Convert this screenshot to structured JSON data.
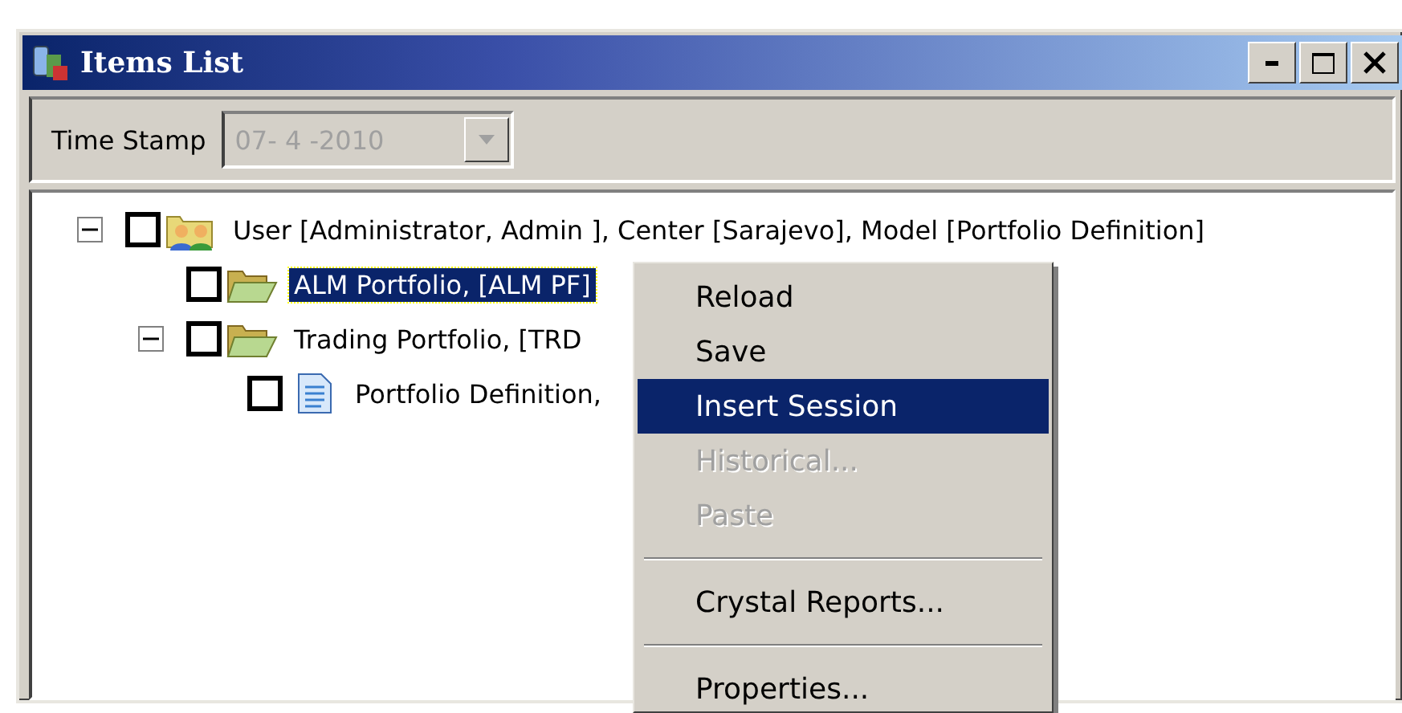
{
  "window": {
    "title": "Items List"
  },
  "toolbar": {
    "label": "Time Stamp",
    "field": {
      "value": "07- 4 -2010",
      "disabled": true
    }
  },
  "tree": [
    {
      "kind": "users",
      "text": "User [Administrator, Admin ], Center [Sarajevo], Model [Portfolio Definition]",
      "expanded": true,
      "checked": false,
      "selected": false,
      "children": [
        {
          "kind": "folder",
          "text": "ALM Portfolio, [ALM PF]",
          "checked": false,
          "selected": true
        },
        {
          "kind": "folder",
          "text": "Trading Portfolio, [TRD",
          "expanded": true,
          "checked": false,
          "selected": false,
          "children": [
            {
              "kind": "document",
              "text": "Portfolio Definition,",
              "checked": false,
              "selected": false
            }
          ]
        }
      ]
    }
  ],
  "context_menu": [
    {
      "kind": "item",
      "label": "Reload",
      "disabled": false,
      "selected": false
    },
    {
      "kind": "item",
      "label": "Save",
      "disabled": false,
      "selected": false
    },
    {
      "kind": "item",
      "label": "Insert Session",
      "disabled": false,
      "selected": true
    },
    {
      "kind": "item",
      "label": "Historical...",
      "disabled": true,
      "selected": false
    },
    {
      "kind": "item",
      "label": "Paste",
      "disabled": true,
      "selected": false
    },
    {
      "kind": "separator"
    },
    {
      "kind": "item",
      "label": "Crystal Reports...",
      "disabled": false,
      "selected": false
    },
    {
      "kind": "separator"
    },
    {
      "kind": "item",
      "label": "Properties...",
      "disabled": false,
      "selected": false
    }
  ]
}
